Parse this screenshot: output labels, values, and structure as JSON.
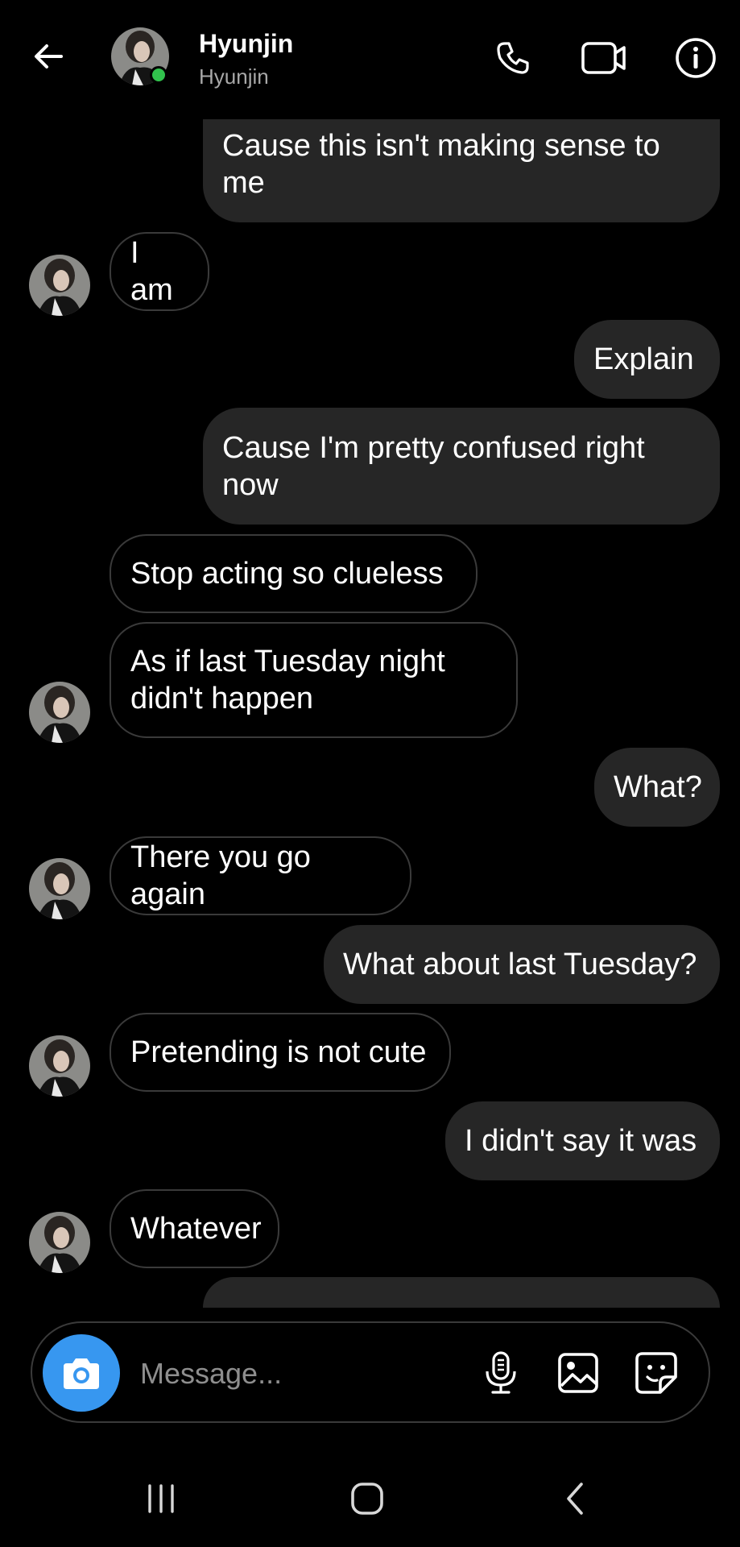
{
  "header": {
    "name": "Hyunjin",
    "username": "Hyunjin"
  },
  "messages": [
    {
      "from": "me",
      "text": "Cause this isn't making sense to me"
    },
    {
      "from": "them",
      "text": "I am"
    },
    {
      "from": "me",
      "text": "Explain"
    },
    {
      "from": "me",
      "text": "Cause I'm pretty confused right now"
    },
    {
      "from": "them",
      "text": "Stop acting so clueless"
    },
    {
      "from": "them",
      "text": "As if last Tuesday night didn't happen"
    },
    {
      "from": "me",
      "text": "What?"
    },
    {
      "from": "them",
      "text": "There you go again"
    },
    {
      "from": "me",
      "text": "What about last Tuesday?"
    },
    {
      "from": "them",
      "text": "Pretending is not cute"
    },
    {
      "from": "me",
      "text": "I didn't say it was"
    },
    {
      "from": "them",
      "text": "Whatever"
    }
  ],
  "composer": {
    "placeholder": "Message..."
  },
  "icons": {
    "back": "arrow-left-icon",
    "call": "phone-icon",
    "video": "video-camera-icon",
    "info": "info-icon",
    "camera": "camera-icon",
    "mic": "microphone-icon",
    "gallery": "image-icon",
    "sticker": "sticker-icon",
    "nav_recents": "recents-icon",
    "nav_home": "home-icon",
    "nav_back": "chevron-left-icon"
  },
  "colors": {
    "background": "#000000",
    "my_bubble": "#262626",
    "their_bubble_border": "#3a3a3a",
    "accent": "#3797f0",
    "online": "#31c24d",
    "secondary_text": "#a8a8a8"
  }
}
